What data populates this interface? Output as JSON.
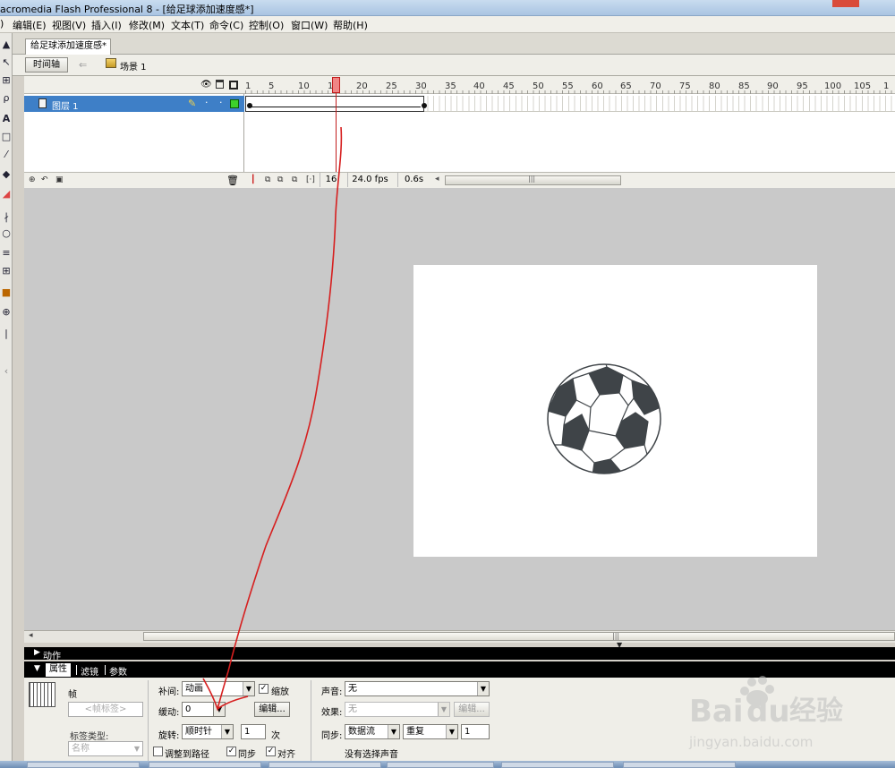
{
  "window": {
    "title": "acromedia Flash Professional 8 - [给足球添加速度感*]"
  },
  "menu": [
    "编辑(E)",
    "视图(V)",
    "插入(I)",
    "修改(M)",
    "文本(T)",
    "命令(C)",
    "控制(O)",
    "窗口(W)",
    "帮助(H)"
  ],
  "document_tab": "给足球添加速度感*",
  "editbar": {
    "timeline_button": "时间轴",
    "scene": "场景 1"
  },
  "timeline": {
    "ruler": [
      "1",
      "5",
      "10",
      "15",
      "20",
      "25",
      "30",
      "35",
      "40",
      "45",
      "50",
      "55",
      "60",
      "65",
      "70",
      "75",
      "80",
      "85",
      "90",
      "95",
      "100",
      "105",
      "1"
    ],
    "layer": {
      "name": "图层 1"
    },
    "current_frame": "16",
    "fps": "24.0 fps",
    "elapsed": "0.6s"
  },
  "panels": {
    "actions": "动作",
    "tabs": [
      "属性",
      "滤镜",
      "参数"
    ]
  },
  "properties": {
    "frame_label": "帧",
    "frame_label_placeholder": "<帧标签>",
    "label_type_label": "标签类型:",
    "label_type_value": "名称",
    "tween_label": "补间:",
    "tween_value": "动画",
    "scale_label": "缩放",
    "ease_label": "缓动:",
    "ease_value": "0",
    "edit_button": "编辑...",
    "rotate_label": "旋转:",
    "rotate_value": "顺时针",
    "rotate_times": "1",
    "times_unit": "次",
    "orient_to_path": "调整到路径",
    "sync_label": "同步",
    "snap_label": "对齐",
    "sound_label": "声音:",
    "sound_value": "无",
    "effect_label": "效果:",
    "effect_value": "无",
    "effect_edit": "编辑...",
    "sync_sound_label": "同步:",
    "sync_sound_value": "数据流",
    "repeat_value": "重复",
    "repeat_count": "1",
    "no_sound": "没有选择声音"
  },
  "watermark": {
    "brand": "Bai",
    "brand2": "du",
    "cn": "经验",
    "url": "jingyan.baidu.com"
  },
  "colors": {
    "layer_selected": "#3e7fc7",
    "playhead": "#c21d1d",
    "ball_dark": "#3f4448",
    "annotation": "#d61f1f"
  }
}
